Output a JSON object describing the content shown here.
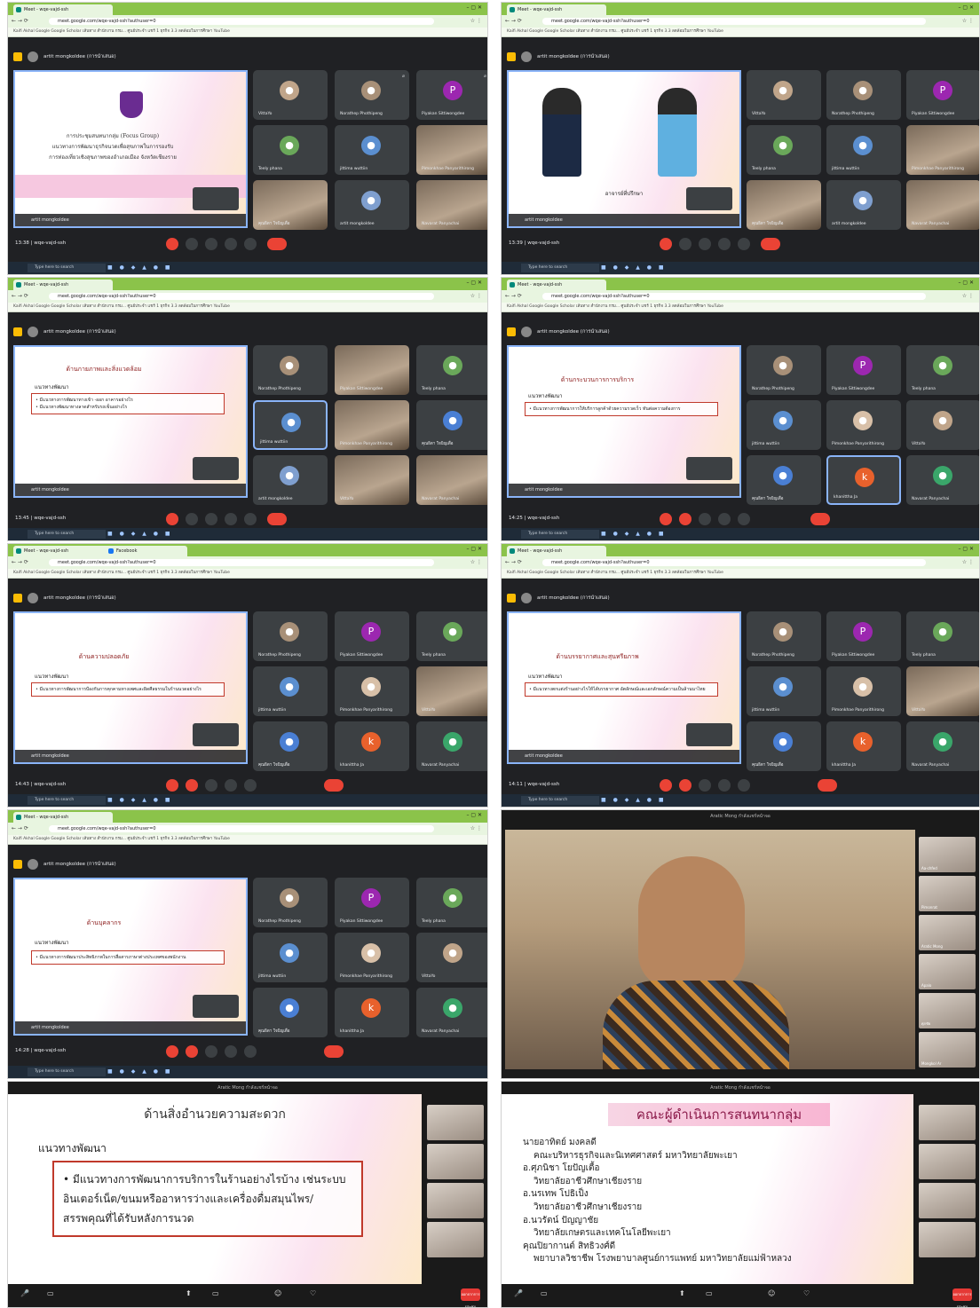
{
  "chrome": {
    "tab_title": "Meet - wqe-vajd-ssh",
    "tab_title_fb": "Facebook",
    "url": "meet.google.com/wqe-vajd-ssh?authuser=0",
    "bookmarks": "Kaifi Akhal   Google   Google Scholar   เส้นทาง   สำนักงาน กรม...   ศูนย์ประจำ   แชร์ 1 ธุรกิจ   3.3 ลดล้อมในการศึกษา   YouTube",
    "taskbar_search": "Type here to search",
    "presenter": "artit mongkoldee (การนำเสนอ)",
    "presenter_short": "artit mongkoldee",
    "meeting_code": "wqe-vajd-ssh"
  },
  "panels": [
    {
      "time": "13:38",
      "cover_title": "การประชุมสนทนากลุ่ม (Focus Group)",
      "cover_lines": [
        "แนวทางการพัฒนาธุรกิจนวดเพื่อสุขภาพในการรองรับ",
        "การท่องเที่ยวเชิงสุขภาพของอำเภอเมือง จังหวัดเชียงราย"
      ],
      "participants": [
        "VittaYo",
        "Norathep Phothipeng",
        "Piyakan Sittiwongdee",
        "Teely phana",
        "jittima wuttiin",
        "Pimonkhae Panyarithirong",
        "คุณธิตา ใจบิญเตื่อ",
        "artit mongkoldee",
        "Navarat Panyachai"
      ]
    },
    {
      "time": "13:39",
      "slide_caption": "อาจารย์ที่ปรึกษา",
      "participants": [
        "VittaYo",
        "Norathep Phothipeng",
        "Piyakan Sittiwongdee",
        "Teely phana",
        "jittima wuttiin",
        "Pimonkhae Panyarithirong",
        "คุณธิตา ใจบิญเตื่อ",
        "artit mongkoldee",
        "Navarat Panyachai"
      ]
    },
    {
      "time": "13:45",
      "slide_title": "ด้านกายภาพและสิ่งแวดล้อม",
      "slide_sub": "แนวทางพัฒนา",
      "bullets": [
        "มีแนวทางการพัฒนาทางเข้า -ออก อาคารอย่างไร",
        "มีแนวทางพัฒนาทางลาดสำหรับรถเข็นอย่างไร"
      ],
      "participants": [
        "Norathep Phothipeng",
        "Piyakan Sittiwongdee",
        "Teely phana",
        "jittima wuttiin",
        "Pimonkhae Panyarithirong",
        "คุณธิตา ใจบิญเตื่อ",
        "artit mongkoldee",
        "VittaYo",
        "Navarat Panyachai"
      ]
    },
    {
      "time": "14:25",
      "slide_title": "ด้านกระบวนการการบริการ",
      "slide_sub": "แนวทางพัฒนา",
      "bullets": [
        "มีแนวทางการพัฒนาการให้บริการลูกค้าด้วยความรวดเร็ว ทันต่อความต้องการ"
      ],
      "participants": [
        "Norathep Phothipeng",
        "Piyakan Sittiwongdee",
        "Teely phana",
        "jittima wuttiin",
        "Pimonkhae Panyarithirong",
        "VittaYo",
        "คุณธิตา ใจบิญเตื่อ",
        "khanittha Ja",
        "Navarat Panyachai"
      ]
    },
    {
      "time": "14:43",
      "slide_title": "ด้านความปลอดภัย",
      "slide_sub": "แนวทางพัฒนา",
      "bullets": [
        "มีแนวทางการพัฒนาการป้องกันการคุกคามทางเพศและผิดศีลธรรมในร้านนวดอย่างไร"
      ],
      "participants": [
        "Norathep Phothipeng",
        "Piyakan Sittiwongdee",
        "Teely phana",
        "jittima wuttiin",
        "Pimonkhae Panyarithirong",
        "VittaYo",
        "คุณธิตา ใจบิญเตื่อ",
        "khanittha Ja",
        "Navarat Panyachai"
      ]
    },
    {
      "time": "14:11",
      "slide_title": "ด้านบรรยากาศและสุนทรียภาพ",
      "slide_sub": "แนวทางพัฒนา",
      "bullets": [
        "มีแนวทางตกแต่งร้านอย่างไรให้ได้บรรยากาศ อัตลักษณ์และเอกลักษณ์ความเป็นล้านนาไทย"
      ],
      "participants": [
        "Norathep Phothipeng",
        "Piyakan Sittiwongdee",
        "Teely phana",
        "jittima wuttiin",
        "Pimonkhae Panyarithirong",
        "VittaYo",
        "คุณธิตา ใจบิญเตื่อ",
        "khanittha Ja",
        "Navarat Panyachai"
      ]
    },
    {
      "time": "14:28",
      "slide_title": "ด้านบุคลากร",
      "slide_sub": "แนวทางพัฒนา",
      "bullets": [
        "มีแนวทางการพัฒนาประสิทธิภาพในการสื่อสารภาษาต่างประเทศของพนักงาน"
      ],
      "participants": [
        "Norathep Phothipeng",
        "Piyakan Sittiwongdee",
        "Teely phana",
        "jittima wuttiin",
        "Pimonkhae Panyarithirong",
        "VittaYo",
        "คุณธิตา ใจบิญเตื่อ",
        "khanittha Ja",
        "Navarat Panyachai"
      ]
    }
  ],
  "zoom": {
    "title": "Aratic Mong กำลังแชร์หน้าจอ",
    "speaker_view_names": [
      "Aa-chfed",
      "Pimonrat",
      "Aratic Mong",
      "Apalo",
      "ศุภชัย",
      "Mongkol Ar"
    ],
    "end_label": "ออกจากการประชุม"
  },
  "slide_facility": {
    "title": "ด้านสิ่งอำนวยความสะดวก",
    "sub": "แนวทางพัฒนา",
    "bullet": "มีแนวทางการพัฒนาการบริการในร้านอย่างไรบ้าง เช่นระบบอินเตอร์เน็ต/ขนมหรืออาหารว่างและเครื่องดื่มสมุนไพร/สรรพคุณที่ได้รับหลังการนวด"
  },
  "slide_committee": {
    "title": "คณะผู้ดำเนินการสนทนากลุ่ม",
    "lines": [
      {
        "text": "นายอาทิตย์ มงคลดี",
        "indent": false
      },
      {
        "text": "คณะบริหารธุรกิจและนิเทศศาสตร์ มหาวิทยาลัยพะเยา",
        "indent": true
      },
      {
        "text": "อ.ศุภนิชา โยปัญเตื้อ",
        "indent": false
      },
      {
        "text": "วิทยาลัยอาชีวศึกษาเชียงราย",
        "indent": true
      },
      {
        "text": "อ.นรเทพ โปธิเป็ง",
        "indent": false
      },
      {
        "text": "วิทยาลัยอาชีวศึกษาเชียงราย",
        "indent": true
      },
      {
        "text": "อ.นวรัตน์ ปัญญาชัย",
        "indent": false
      },
      {
        "text": "วิทยาลัยเกษตรและเทคโนโลยีพะเยา",
        "indent": true
      },
      {
        "text": "คุณปิยากานต์ สิทธิวงศ์ดี",
        "indent": false
      },
      {
        "text": "พยาบาลวิชาชีพ โรงพยาบาลศูนย์การแพทย์ มหาวิทยาลัยแม่ฟ้าหลวง",
        "indent": true
      }
    ]
  }
}
